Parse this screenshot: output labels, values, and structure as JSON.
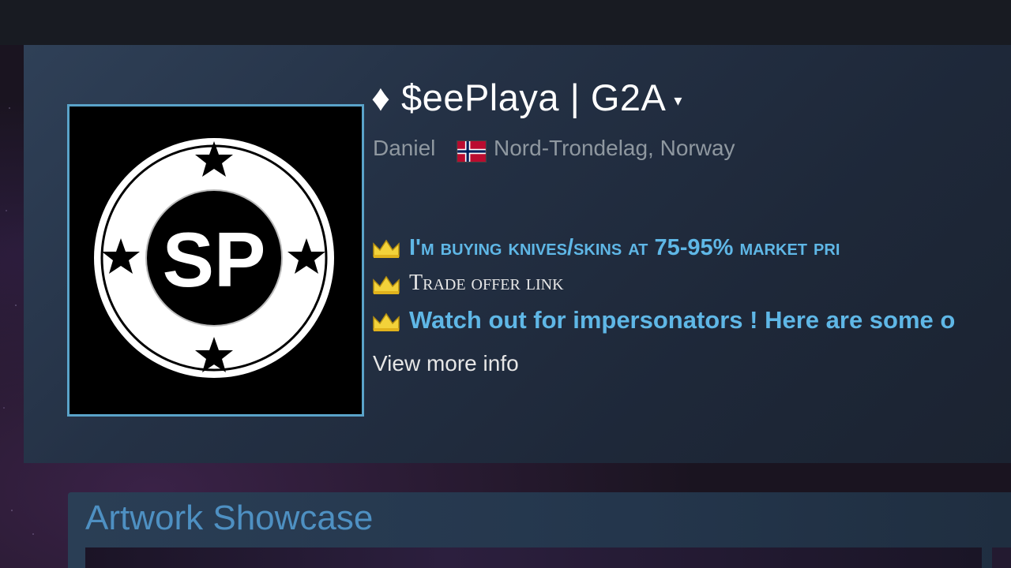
{
  "profile": {
    "persona_name": "♦ $eePlaya | G2A",
    "caret": "▾",
    "real_name": "Daniel",
    "location": "Nord-Trondelag, Norway",
    "flag_country": "Norway",
    "avatar_text": "SP",
    "summary": [
      "I'm buying knives/skins at 75-95% market pri",
      "Trade offer link",
      "Watch out for impersonators ! Here are some o"
    ],
    "view_more": "View more info"
  },
  "showcase": {
    "title": "Artwork Showcase"
  },
  "colors": {
    "accent_blue": "#5fb7e6",
    "frame_blue": "#5aa3c9",
    "muted_text": "#8f98a0",
    "showcase_title": "#4e90c2"
  },
  "icons": {
    "crown": "crown-icon",
    "flag": "norway-flag-icon",
    "dropdown": "chevron-down-icon"
  }
}
